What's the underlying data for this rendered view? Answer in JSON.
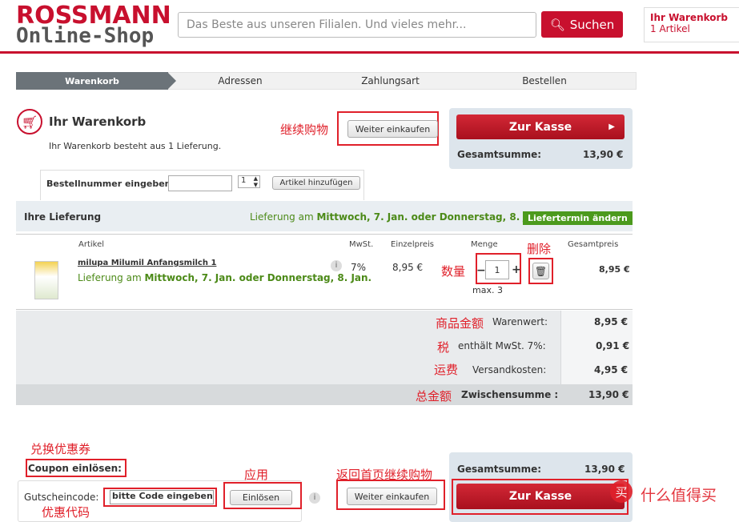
{
  "header": {
    "logo_top": "ROSSMANN",
    "logo_bottom": "Online-Shop",
    "search_placeholder": "Das Beste aus unseren Filialen. Und vieles mehr...",
    "search_button": "Suchen",
    "cart_title": "Ihr Warenkorb",
    "cart_count": "1 Artikel"
  },
  "steps": [
    "Warenkorb",
    "Adressen",
    "Zahlungsart",
    "Bestellen"
  ],
  "cart": {
    "title": "Ihr Warenkorb",
    "subtitle": "Ihr Warenkorb besteht aus 1 Lieferung.",
    "continue_shopping": "Weiter einkaufen",
    "checkout": "Zur Kasse",
    "total_label": "Gesamtsumme:",
    "total_value": "13,90 €"
  },
  "order_number": {
    "label": "Bestellnummer eingeben:",
    "qty": "1",
    "add_button": "Artikel hinzufügen"
  },
  "delivery": {
    "label": "Ihre Lieferung",
    "date_prefix": "Lieferung am",
    "date_text": "Mittwoch, 7. Jan. oder Donnerstag, 8. Jan.",
    "change_button": "Liefertermin ändern"
  },
  "table": {
    "headers": [
      "Artikel",
      "MwSt.",
      "Einzelpreis",
      "Menge",
      "Gesamtpreis"
    ],
    "item": {
      "name": "milupa Milumil Anfangsmilch 1",
      "delivery_prefix": "Lieferung am",
      "delivery_date": "Mittwoch, 7. Jan. oder Donnerstag, 8. Jan.",
      "mwst": "7%",
      "price": "8,95 €",
      "qty": "1",
      "qty_max": "max. 3",
      "total": "8,95 €"
    }
  },
  "summary": {
    "rows": [
      {
        "label": "Warenwert:",
        "value": "8,95 €"
      },
      {
        "label": "enthält MwSt. 7%:",
        "value": "0,91 €"
      },
      {
        "label": "Versandkosten:",
        "value": "4,95 €"
      }
    ],
    "subtotal_label": "Zwischensumme :",
    "subtotal_value": "13,90 €"
  },
  "coupon": {
    "title": "Coupon einlösen:",
    "code_label": "Gutscheincode:",
    "code_placeholder": "bitte Code eingeben",
    "redeem": "Einlösen",
    "continue_shopping": "Weiter einkaufen"
  },
  "bottom": {
    "total_label": "Gesamtsumme:",
    "total_value": "13,90 €",
    "checkout": "Zur Kasse"
  },
  "annotations": {
    "continue": "继续购物",
    "delete": "删除",
    "quantity": "数量",
    "goods_amount": "商品金额",
    "tax": "税",
    "shipping": "运费",
    "total": "总金额",
    "coupon_redeem": "兑换优惠券",
    "apply": "应用",
    "back_home": "返回首页继续购物",
    "coupon_code": "优惠代码"
  },
  "watermark": "什么值得买",
  "colors": {
    "brand": "#c8102e",
    "green": "#4c9a1d",
    "panel": "#dde5ec",
    "annotation": "#e0202a"
  }
}
